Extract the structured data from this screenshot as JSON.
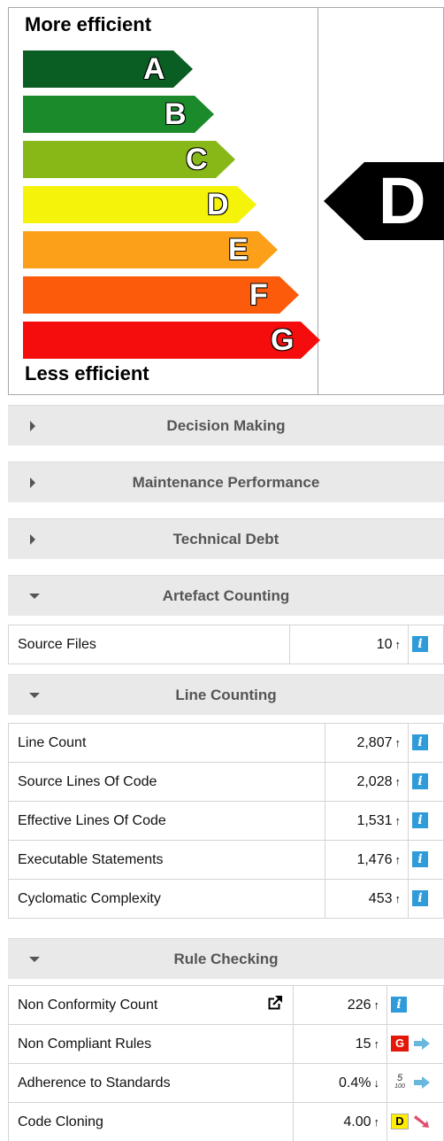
{
  "energy_label": {
    "top_text": "More efficient",
    "bottom_text": "Less efficient",
    "rating": "D",
    "grades": [
      {
        "letter": "A",
        "color": "#0a5e24"
      },
      {
        "letter": "B",
        "color": "#1b8a2b"
      },
      {
        "letter": "C",
        "color": "#88b818"
      },
      {
        "letter": "D",
        "color": "#f6f30a"
      },
      {
        "letter": "E",
        "color": "#fba018"
      },
      {
        "letter": "F",
        "color": "#fb5b0b"
      },
      {
        "letter": "G",
        "color": "#f50d0d"
      }
    ]
  },
  "sections": {
    "decision_making": "Decision Making",
    "maintenance_performance": "Maintenance Performance",
    "technical_debt": "Technical Debt",
    "artefact_counting": "Artefact Counting",
    "line_counting": "Line Counting",
    "rule_checking": "Rule Checking"
  },
  "artefact_counting": {
    "rows": [
      {
        "label": "Source Files",
        "value": "10"
      }
    ]
  },
  "line_counting": {
    "rows": [
      {
        "label": "Line Count",
        "value": "2,807"
      },
      {
        "label": "Source Lines Of Code",
        "value": "2,028"
      },
      {
        "label": "Effective Lines Of Code",
        "value": "1,531"
      },
      {
        "label": "Executable Statements",
        "value": "1,476"
      },
      {
        "label": "Cyclomatic Complexity",
        "value": "453"
      }
    ]
  },
  "rule_checking": {
    "rows": [
      {
        "label": "Non Conformity Count",
        "value": "226",
        "trend": "↑",
        "badge": "info"
      },
      {
        "label": "Non Compliant Rules",
        "value": "15",
        "trend": "↑",
        "badge": "G"
      },
      {
        "label": "Adherence to Standards",
        "value": "0.4%",
        "trend": "↓",
        "badge_num": "5",
        "badge_den": "100"
      },
      {
        "label": "Code Cloning",
        "value": "4.00",
        "trend": "↑",
        "badge": "D"
      }
    ]
  },
  "symbols": {
    "up": "↑",
    "info": "i"
  }
}
